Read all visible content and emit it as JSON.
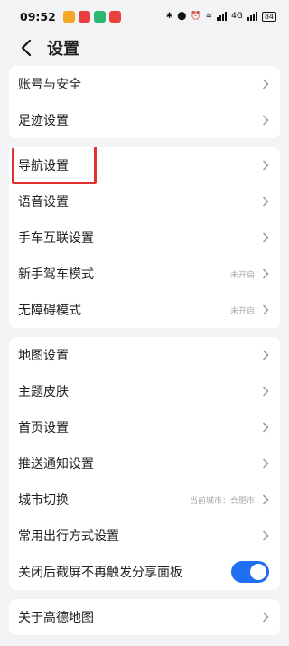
{
  "status_bar": {
    "time": "09:52",
    "network": "4G",
    "battery": "84",
    "app_colors": [
      "#f5a623",
      "#e83e3e",
      "#2bb673",
      "#e8413e"
    ]
  },
  "header": {
    "title": "设置",
    "back_icon": "chevron-left-icon"
  },
  "groups": [
    {
      "items": [
        {
          "label": "账号与安全"
        },
        {
          "label": "足迹设置"
        }
      ]
    },
    {
      "items": [
        {
          "label": "导航设置",
          "highlighted": true
        },
        {
          "label": "语音设置"
        },
        {
          "label": "手车互联设置"
        },
        {
          "label": "新手驾车模式",
          "value": "未开启"
        },
        {
          "label": "无障碍模式",
          "value": "未开启"
        }
      ]
    },
    {
      "items": [
        {
          "label": "地图设置"
        },
        {
          "label": "主题皮肤"
        },
        {
          "label": "首页设置"
        },
        {
          "label": "推送通知设置"
        },
        {
          "label": "城市切换",
          "value": "当前城市：合肥市"
        },
        {
          "label": "常用出行方式设置"
        },
        {
          "label": "关闭后截屏不再触发分享面板",
          "toggle": true,
          "toggle_on": true
        }
      ]
    },
    {
      "items": [
        {
          "label": "关于高德地图"
        }
      ]
    }
  ],
  "colors": {
    "accent": "#1f6ff0",
    "highlight_box": "#e0332e",
    "background": "#f2f3f5"
  }
}
